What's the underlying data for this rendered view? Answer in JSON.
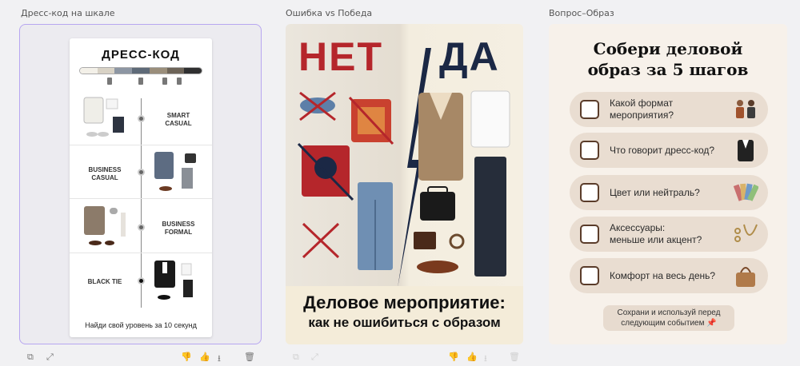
{
  "cards": [
    {
      "title": "Дресс-код на шкале"
    },
    {
      "title": "Ошибка vs Победа"
    },
    {
      "title": "Вопрос–Образ"
    }
  ],
  "card1": {
    "heading": "ДРЕСС-КОД",
    "scale_colors": [
      "#f3f0e8",
      "#d8d2c5",
      "#8d96a3",
      "#5e6a78",
      "#9a8e7b",
      "#6d6458",
      "#2f2f30"
    ],
    "levels": [
      {
        "label_line1": "SMART",
        "label_line2": "CASUAL"
      },
      {
        "label_line1": "BUSINESS",
        "label_line2": "CASUAL"
      },
      {
        "label_line1": "BUSINESS",
        "label_line2": "FORMAL"
      },
      {
        "label_line1": "BLACK TIE",
        "label_line2": ""
      }
    ],
    "footer": "Найди свой уровень за 10 секунд"
  },
  "card2": {
    "no": "НЕТ",
    "yes": "ДА",
    "line1": "Деловое мероприятие:",
    "line2": "как не ошибиться с образом"
  },
  "card3": {
    "title_line1": "Собери деловой",
    "title_line2": "образ за 5 шагов",
    "items": [
      {
        "line1": "Какой формат",
        "line2": "мероприятия?"
      },
      {
        "line1": "Что говорит дресс-код?",
        "line2": ""
      },
      {
        "line1": "Цвет или нейтраль?",
        "line2": ""
      },
      {
        "line1": "Аксессуары:",
        "line2": "меньше или акцент?"
      },
      {
        "line1": "Комфорт на весь день?",
        "line2": ""
      }
    ],
    "note_line1": "Сохрани и используй перед",
    "note_line2": "следующим событием 📌"
  },
  "toolbar": {
    "copy": "⧉",
    "expand": "⤢",
    "dislike": "👎",
    "like": "👍",
    "download": "⭳",
    "delete": "🗑"
  },
  "colors": {
    "accent_border": "#b7a6f0",
    "no_red": "#b5262b",
    "yes_navy": "#1b2845"
  }
}
